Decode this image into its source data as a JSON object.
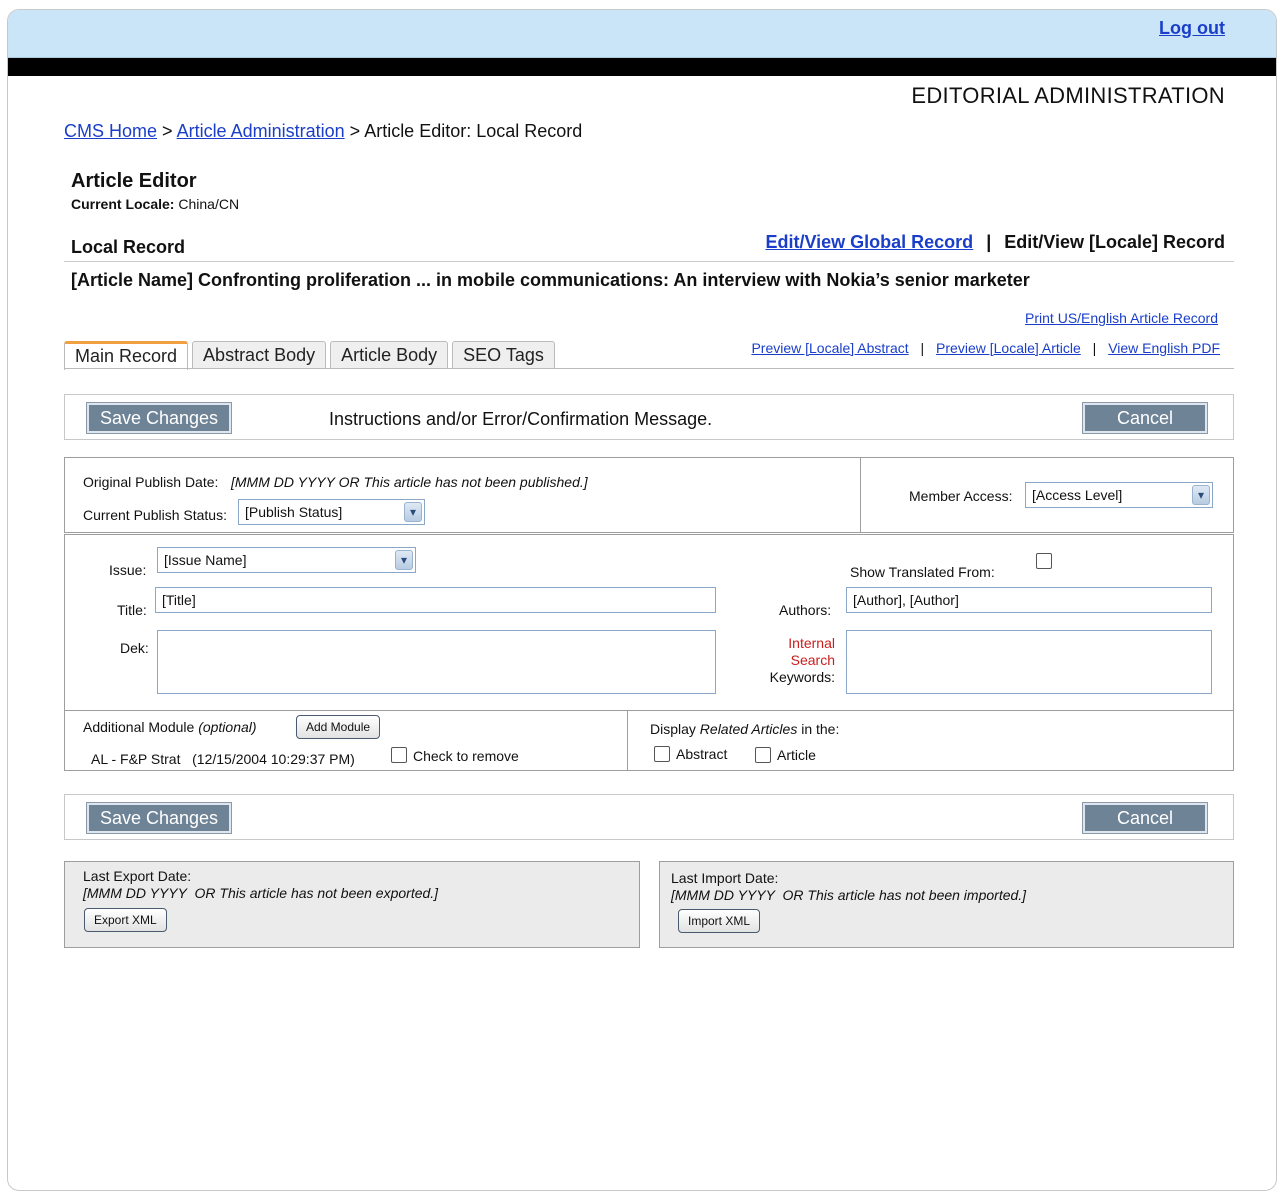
{
  "header": {
    "logout": "Log out",
    "section_title": "EDITORIAL ADMINISTRATION"
  },
  "breadcrumb": {
    "home": "CMS Home",
    "sep": ">",
    "admin": "Article Administration",
    "current": "Article Editor: Local Record"
  },
  "editor": {
    "title": "Article Editor",
    "locale_label": "Current Locale:",
    "locale_value": "China/CN",
    "record_title": "Local Record",
    "global_link": "Edit/View Global Record",
    "pipe": "|",
    "locale_record": "Edit/View [Locale] Record",
    "article_name": "[Article Name] Confronting proliferation ... in mobile communications: An interview with Nokia’s senior marketer"
  },
  "links": {
    "print": "Print US/English Article Record",
    "preview_abstract": "Preview [Locale] Abstract",
    "preview_article": "Preview [Locale]  Article",
    "view_pdf": "View English PDF"
  },
  "tabs": [
    "Main Record",
    "Abstract Body",
    "Article Body",
    "SEO Tags"
  ],
  "actions": {
    "save": "Save Changes",
    "cancel": "Cancel",
    "message": "Instructions and/or Error/Confirmation Message."
  },
  "publish": {
    "original_label": "Original Publish Date:",
    "original_value": "[MMM DD YYYY  OR This article has not been published.]",
    "status_label": "Current Publish Status:",
    "status_value": "[Publish Status]",
    "member_label": "Member Access:",
    "member_value": "[Access Level]"
  },
  "form": {
    "issue_label": "Issue:",
    "issue_value": "[Issue Name]",
    "title_label": "Title:",
    "title_value": "[Title]",
    "dek_label": "Dek:",
    "show_translated": "Show Translated From:",
    "authors_label": "Authors:",
    "authors_value": "[Author], [Author]",
    "keywords_red1": "Internal",
    "keywords_red2": "Search",
    "keywords_label": "Keywords:"
  },
  "modules": {
    "label": "Additional Module",
    "optional": "(optional)",
    "add_button": "Add Module",
    "item": "AL - F&P Strat   (12/15/2004 10:29:37 PM)",
    "remove_label": "Check to remove",
    "related_prefix": "Display",
    "related_italic": "Related Articles",
    "related_suffix": "in the:",
    "abstract_opt": "Abstract",
    "article_opt": "Article"
  },
  "export": {
    "label": "Last Export Date:",
    "value": "[MMM DD YYYY  OR This article has not been exported.]",
    "button": "Export  XML"
  },
  "import": {
    "label": "Last Import Date:",
    "value": "[MMM DD YYYY  OR This article has not been imported.]",
    "button": "Import  XML"
  }
}
